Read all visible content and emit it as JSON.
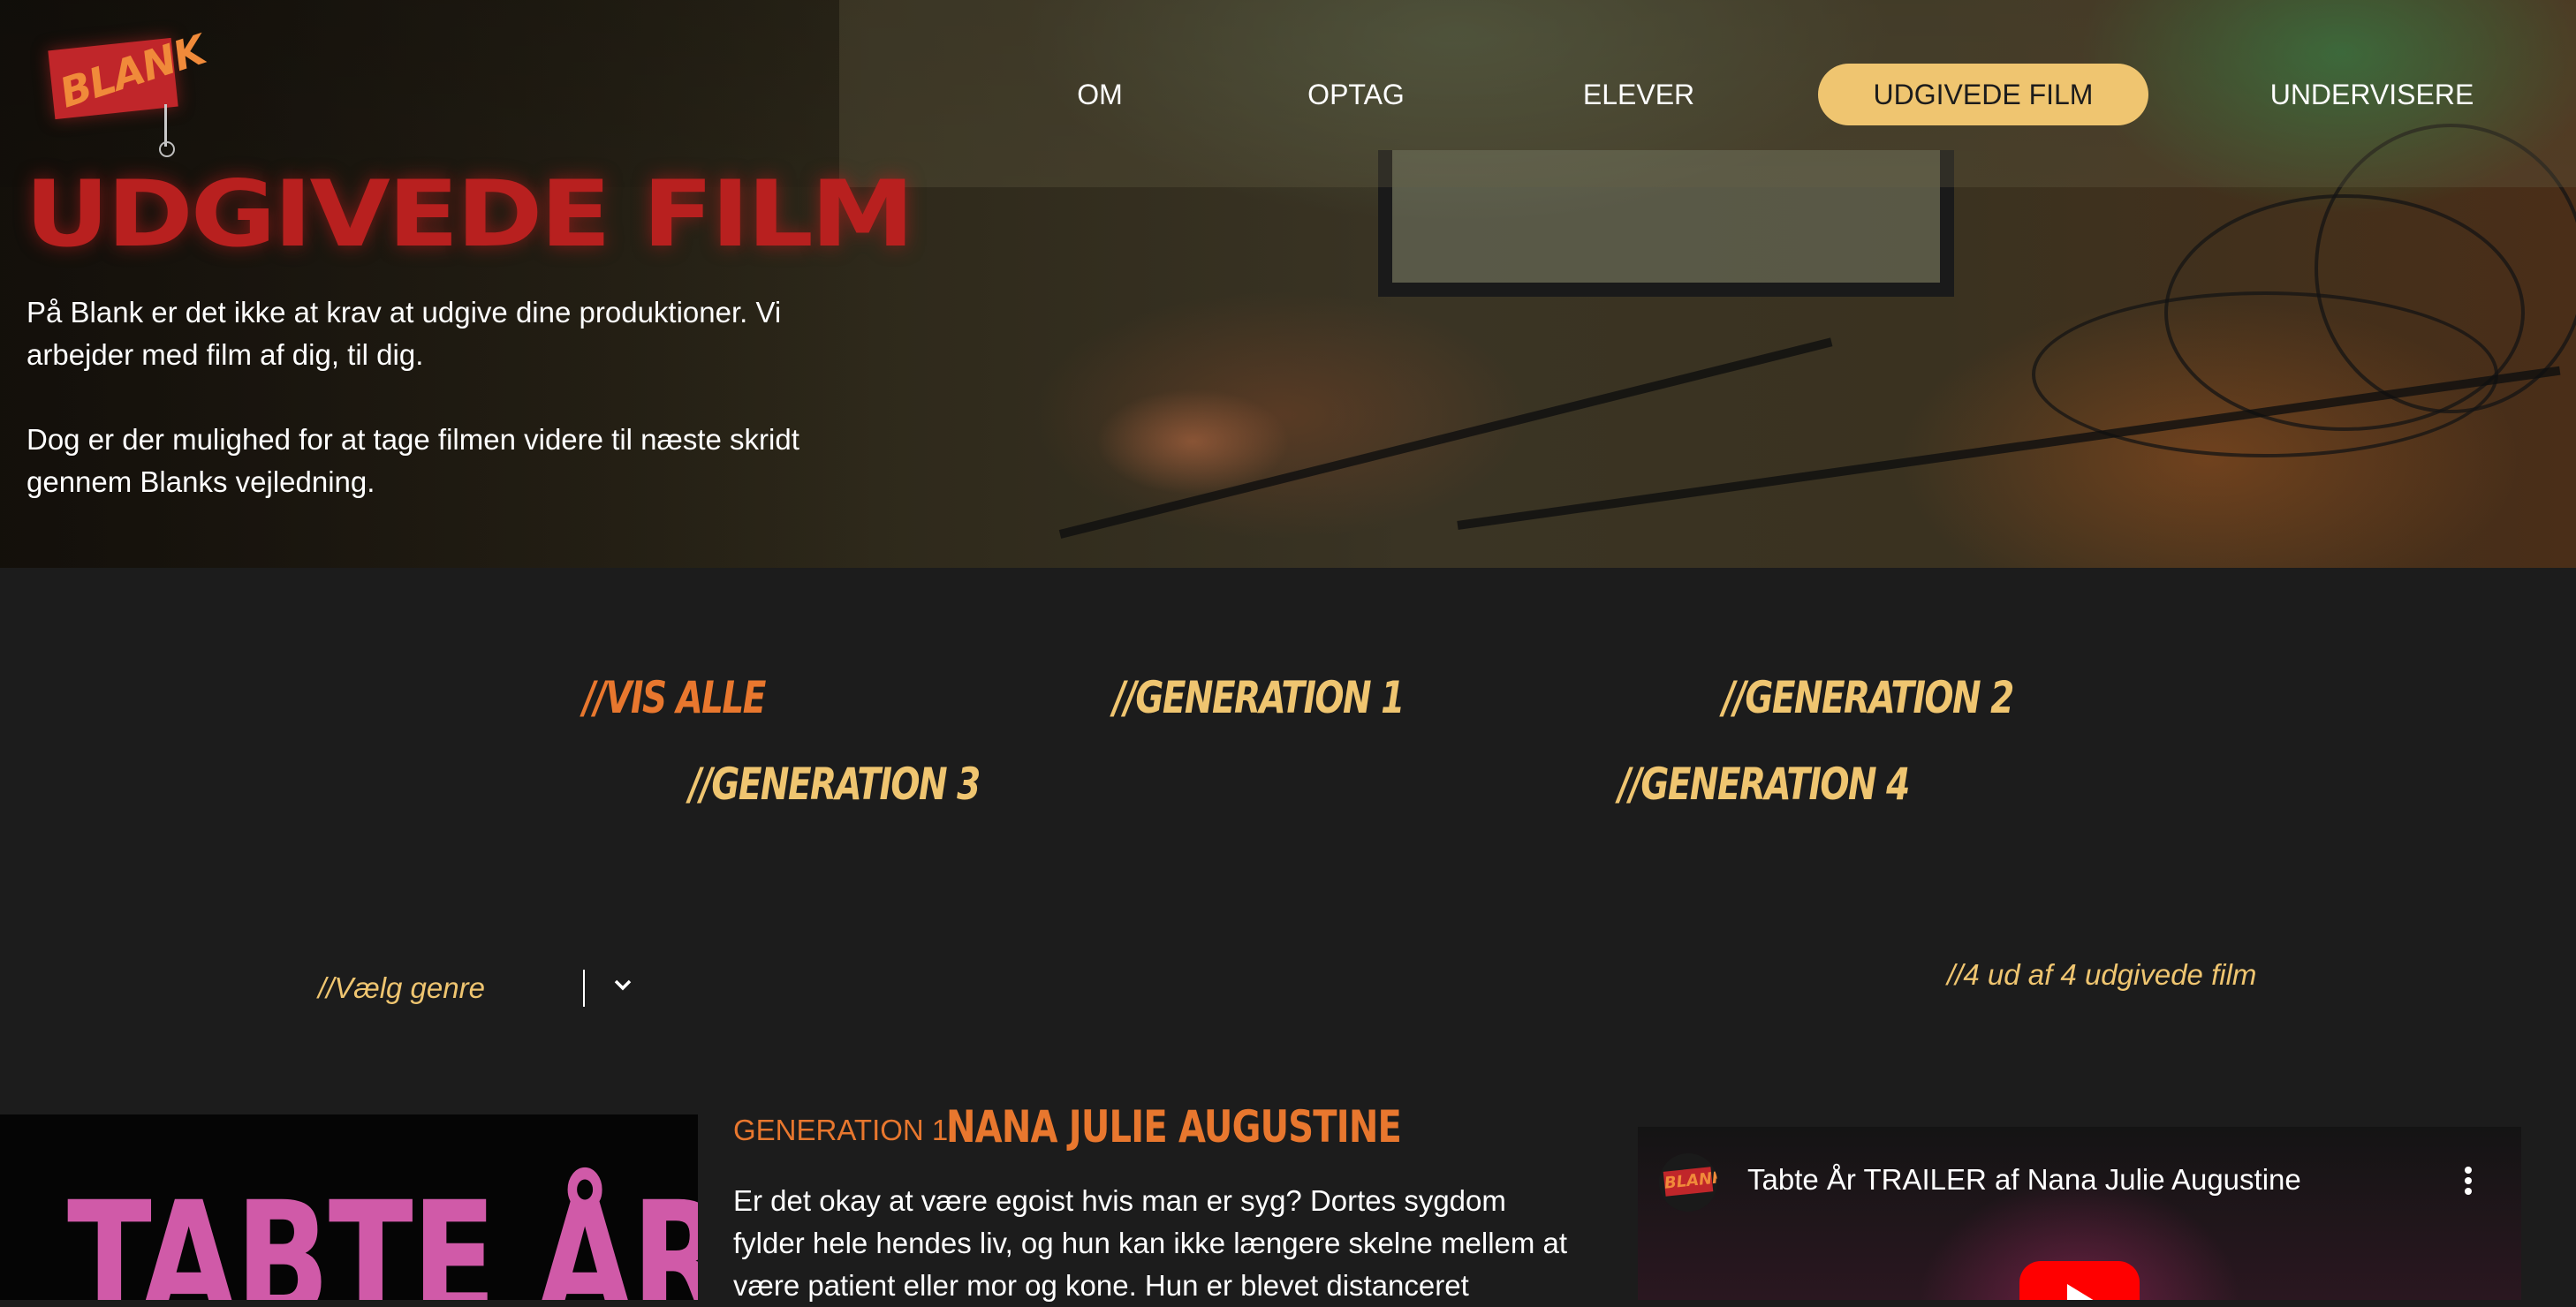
{
  "header": {
    "logo_text": "BLANK",
    "nav": [
      {
        "label": "OM",
        "active": false
      },
      {
        "label": "OPTAG",
        "active": false
      },
      {
        "label": "ELEVER",
        "active": false
      },
      {
        "label": "UDGIVEDE FILM",
        "active": true
      },
      {
        "label": "UNDERVISERE",
        "active": false
      }
    ]
  },
  "hero": {
    "title": "UDGIVEDE FILM",
    "paragraph1": "På Blank er det ikke at krav at udgive dine produktioner. Vi arbejder med film af dig, til dig.",
    "paragraph2": "Dog er der mulighed for at tage filmen videre til næste skridt gennem Blanks vejledning."
  },
  "filters": [
    {
      "label": "//VIS ALLE",
      "active": true
    },
    {
      "label": "//GENERATION 1",
      "active": false
    },
    {
      "label": "//GENERATION 2",
      "active": false
    },
    {
      "label": "//GENERATION 3",
      "active": false
    },
    {
      "label": "//GENERATION 4",
      "active": false
    }
  ],
  "genre_select": {
    "label": "//Vælg genre",
    "icon": "chevron-down-icon"
  },
  "count_text": "//4 ud af 4 udgivede film",
  "film": {
    "poster_title": "TABTE ÅR",
    "generation": "GENERATION 1",
    "director": "NANA JULIE AUGUSTINE",
    "synopsis": "Er det okay at være egoist hvis man er syg? Dortes sygdom fylder hele hendes liv, og hun kan ikke længere skelne mellem at være patient eller mor og kone. Hun er blevet distanceret",
    "video": {
      "channel_logo_text": "BLANK",
      "title": "Tabte År TRAILER af Nana Julie Augustine",
      "more_icon": "more-vertical-icon",
      "play_icon": "play-icon"
    }
  },
  "colors": {
    "background": "#1c1c1c",
    "accent_orange": "#e8772e",
    "accent_yellow": "#efc570",
    "title_red": "#b8201f",
    "poster_pink": "#d05aa8"
  }
}
